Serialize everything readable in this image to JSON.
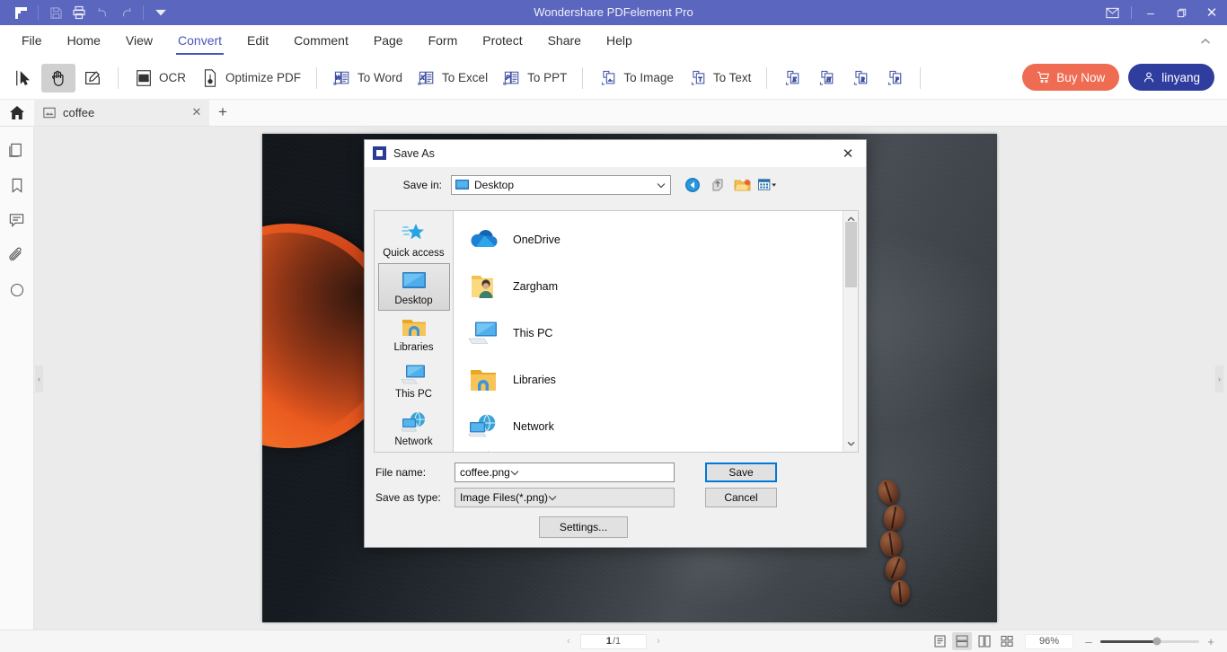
{
  "titlebar": {
    "title": "Wondershare PDFelement Pro",
    "left_icons": [
      "logo-icon",
      "save-icon",
      "print-icon",
      "undo-icon",
      "redo-icon",
      "customize-dropdown-icon"
    ],
    "mail_icon": "mail-icon",
    "minimize": "–",
    "maximize": "❐",
    "close": "✕"
  },
  "menubar": {
    "items": [
      {
        "label": "File",
        "active": false
      },
      {
        "label": "Home",
        "active": false
      },
      {
        "label": "View",
        "active": false
      },
      {
        "label": "Convert",
        "active": true
      },
      {
        "label": "Edit",
        "active": false
      },
      {
        "label": "Comment",
        "active": false
      },
      {
        "label": "Page",
        "active": false
      },
      {
        "label": "Form",
        "active": false
      },
      {
        "label": "Protect",
        "active": false
      },
      {
        "label": "Share",
        "active": false
      },
      {
        "label": "Help",
        "active": false
      }
    ],
    "collapse_icon": "chevron-up-icon"
  },
  "ribbon": {
    "mode_tools": [
      {
        "name": "select-tool",
        "selected": false
      },
      {
        "name": "hand-tool",
        "selected": true
      },
      {
        "name": "edit-tool",
        "selected": false
      }
    ],
    "tools": [
      {
        "label": "OCR",
        "icon": "ocr-icon"
      },
      {
        "label": "Optimize PDF",
        "icon": "optimize-pdf-icon"
      },
      {
        "label": "To Word",
        "icon": "to-word-icon"
      },
      {
        "label": "To Excel",
        "icon": "to-excel-icon"
      },
      {
        "label": "To PPT",
        "icon": "to-ppt-icon"
      },
      {
        "label": "To Image",
        "icon": "to-image-icon"
      },
      {
        "label": "To Text",
        "icon": "to-text-icon"
      }
    ],
    "format_tools": [
      {
        "letter": "E",
        "name": "to-epub-icon"
      },
      {
        "letter": "H",
        "name": "to-html-icon"
      },
      {
        "letter": "R",
        "name": "to-rtf-icon"
      },
      {
        "letter": "P",
        "name": "to-pages-icon"
      }
    ],
    "buy_label": "Buy Now",
    "user_label": "linyang",
    "buy_color": "#ef6b52",
    "user_color": "#2f3d9e"
  },
  "tabstrip": {
    "home_icon": "home-icon",
    "tab_name": "coffee",
    "tab_close": "✕",
    "add_tab": "+"
  },
  "rail": {
    "items": [
      {
        "name": "thumbnails-icon"
      },
      {
        "name": "bookmark-icon"
      },
      {
        "name": "comments-icon"
      },
      {
        "name": "attachment-icon"
      },
      {
        "name": "stamp-icon"
      }
    ]
  },
  "dialog": {
    "title": "Save As",
    "close": "✕",
    "save_in_label": "Save in:",
    "save_in_value": "Desktop",
    "nav_icons": [
      "back-icon",
      "up-one-level-icon",
      "new-folder-icon",
      "view-options-icon"
    ],
    "places": [
      {
        "label": "Quick access",
        "icon": "quick-access-star-icon",
        "selected": false
      },
      {
        "label": "Desktop",
        "icon": "desktop-monitor-icon",
        "selected": true
      },
      {
        "label": "Libraries",
        "icon": "libraries-folder-icon",
        "selected": false
      },
      {
        "label": "This PC",
        "icon": "this-pc-icon",
        "selected": false
      },
      {
        "label": "Network",
        "icon": "network-globe-icon",
        "selected": false
      }
    ],
    "files": [
      {
        "name": "OneDrive",
        "icon": "onedrive-cloud-icon"
      },
      {
        "name": "Zargham",
        "icon": "user-folder-icon"
      },
      {
        "name": "This PC",
        "icon": "this-pc-icon"
      },
      {
        "name": "Libraries",
        "icon": "libraries-folder-icon"
      },
      {
        "name": "Network",
        "icon": "network-globe-icon"
      }
    ],
    "file_name_label": "File name:",
    "file_name_value": "coffee.png",
    "save_as_type_label": "Save as type:",
    "save_as_type_value": "Image Files(*.png)",
    "save_button": "Save",
    "cancel_button": "Cancel",
    "settings_button": "Settings...",
    "accent_color": "#0078d7"
  },
  "statusbar": {
    "prev_page": "‹",
    "next_page": "›",
    "current_page": "1",
    "page_sep": "/1",
    "view_modes": [
      {
        "name": "single-page-view-icon",
        "selected": false
      },
      {
        "name": "continuous-view-icon",
        "selected": true
      },
      {
        "name": "two-page-view-icon",
        "selected": false
      },
      {
        "name": "grid-view-icon",
        "selected": false
      }
    ],
    "zoom_value": "96%",
    "zoom_out": "–",
    "zoom_in": "+"
  }
}
